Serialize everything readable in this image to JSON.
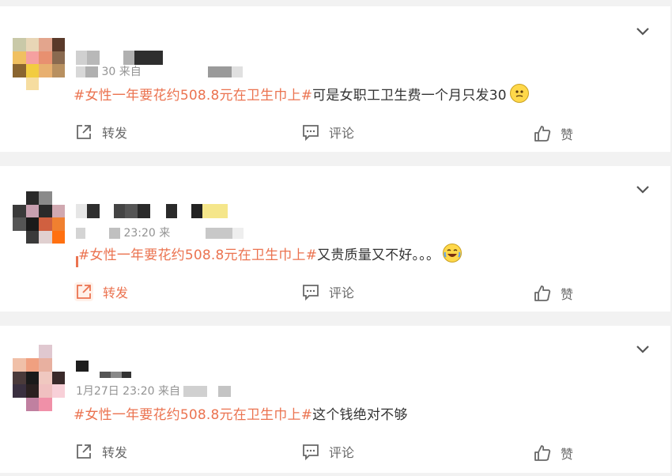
{
  "colors": {
    "hashtag": "#eb7350",
    "text": "#333333",
    "meta": "#939393",
    "action": "#686868",
    "active": "#eb7350"
  },
  "posts": [
    {
      "meta": "30 来自",
      "hashtag": "#女性一年要花约508.8元在卫生巾上#",
      "text": "可是女职工卫生费一个月只发30",
      "emoji": "thinking-face-emoji",
      "actions": {
        "repost": "转发",
        "comment": "评论",
        "like": "赞"
      }
    },
    {
      "meta": "23:20 来",
      "hashtag": "#女性一年要花约508.8元在卫生巾上#",
      "text": "又贵质量又不好。。。",
      "emoji": "crying-laughing-emoji",
      "actions": {
        "repost": "转发",
        "comment": "评论",
        "like": "赞"
      }
    },
    {
      "meta": "1月27日 23:20 来自",
      "hashtag": "#女性一年要花约508.8元在卫生巾上#",
      "text": "这个钱绝对不够",
      "emoji": "",
      "actions": {
        "repost": "转发",
        "comment": "评论",
        "like": "赞"
      }
    }
  ]
}
